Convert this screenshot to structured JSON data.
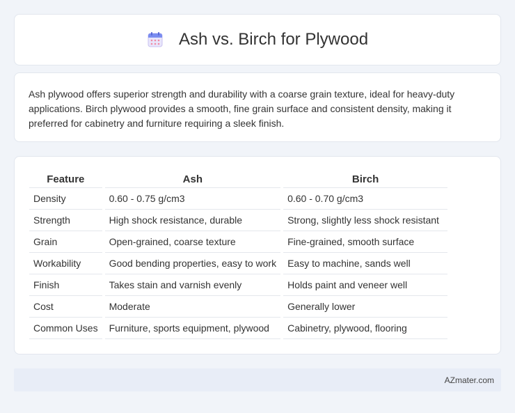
{
  "header": {
    "title": "Ash vs. Birch for Plywood",
    "icon": "calendar-icon"
  },
  "summary": {
    "text": "Ash plywood offers superior strength and durability with a coarse grain texture, ideal for heavy-duty applications. Birch plywood provides a smooth, fine grain surface and consistent density, making it preferred for cabinetry and furniture requiring a sleek finish."
  },
  "table": {
    "columns": [
      "Feature",
      "Ash",
      "Birch"
    ],
    "rows": [
      [
        "Density",
        "0.60 - 0.75 g/cm3",
        "0.60 - 0.70 g/cm3"
      ],
      [
        "Strength",
        "High shock resistance, durable",
        "Strong, slightly less shock resistant"
      ],
      [
        "Grain",
        "Open-grained, coarse texture",
        "Fine-grained, smooth surface"
      ],
      [
        "Workability",
        "Good bending properties, easy to work",
        "Easy to machine, sands well"
      ],
      [
        "Finish",
        "Takes stain and varnish evenly",
        "Holds paint and veneer well"
      ],
      [
        "Cost",
        "Moderate",
        "Generally lower"
      ],
      [
        "Common Uses",
        "Furniture, sports equipment, plywood",
        "Cabinetry, plywood, flooring"
      ]
    ]
  },
  "footer": {
    "text": "AZmater.com"
  },
  "colors": {
    "background": "#f1f4f9",
    "card": "#ffffff",
    "footer_bg": "#e8edf7"
  }
}
